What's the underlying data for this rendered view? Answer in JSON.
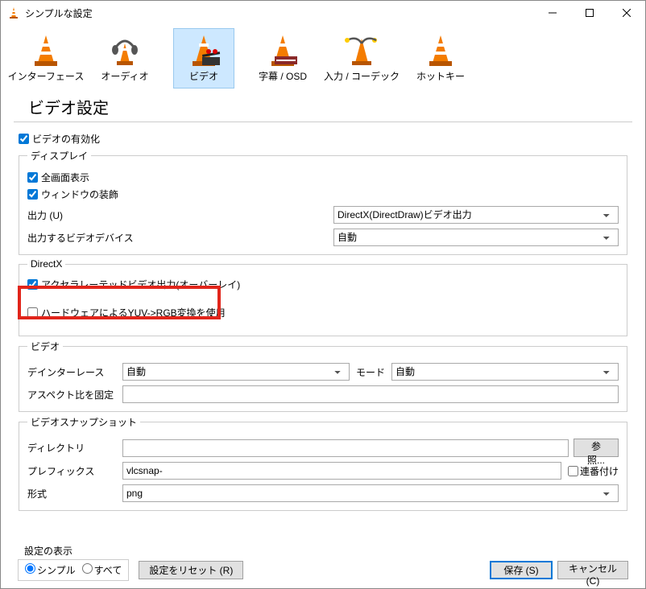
{
  "window": {
    "title": "シンプルな設定"
  },
  "toolbar": {
    "items": [
      {
        "label": "インターフェース"
      },
      {
        "label": "オーディオ"
      },
      {
        "label": "ビデオ",
        "selected": true
      },
      {
        "label": "字幕 / OSD"
      },
      {
        "label": "入力 / コーデック"
      },
      {
        "label": "ホットキー"
      }
    ]
  },
  "page": {
    "title": "ビデオ設定"
  },
  "video": {
    "enable_label": "ビデオの有効化",
    "enable_checked": true
  },
  "display": {
    "legend": "ディスプレイ",
    "fullscreen_label": "全画面表示",
    "fullscreen_checked": true,
    "decoration_label": "ウィンドウの装飾",
    "decoration_checked": true,
    "output_label": "出力 (U)",
    "output_value": "DirectX(DirectDraw)ビデオ出力",
    "device_label": "出力するビデオデバイス",
    "device_value": "自動"
  },
  "directx": {
    "legend": "DirectX",
    "accel_label": "アクセラレーテッドビデオ出力(オーバーレイ)",
    "accel_checked": true,
    "yuv_label": "ハードウェアによるYUV->RGB変換を使用",
    "yuv_checked": false
  },
  "video_group": {
    "legend": "ビデオ",
    "deinterlace_label": "デインターレース",
    "deinterlace_value": "自動",
    "mode_label": "モード",
    "mode_value": "自動",
    "aspect_label": "アスペクト比を固定",
    "aspect_value": ""
  },
  "snapshot": {
    "legend": "ビデオスナップショット",
    "dir_label": "ディレクトリ",
    "dir_value": "",
    "browse_label": "参照...",
    "prefix_label": "プレフィックス",
    "prefix_value": "vlcsnap-",
    "seq_label": "連番付け",
    "seq_checked": false,
    "format_label": "形式",
    "format_value": "png"
  },
  "footer": {
    "show_label": "設定の表示",
    "simple_label": "シンプル",
    "all_label": "すべて",
    "reset_label": "設定をリセット (R)",
    "save_label": "保存 (S)",
    "cancel_label": "キャンセル (C)"
  }
}
